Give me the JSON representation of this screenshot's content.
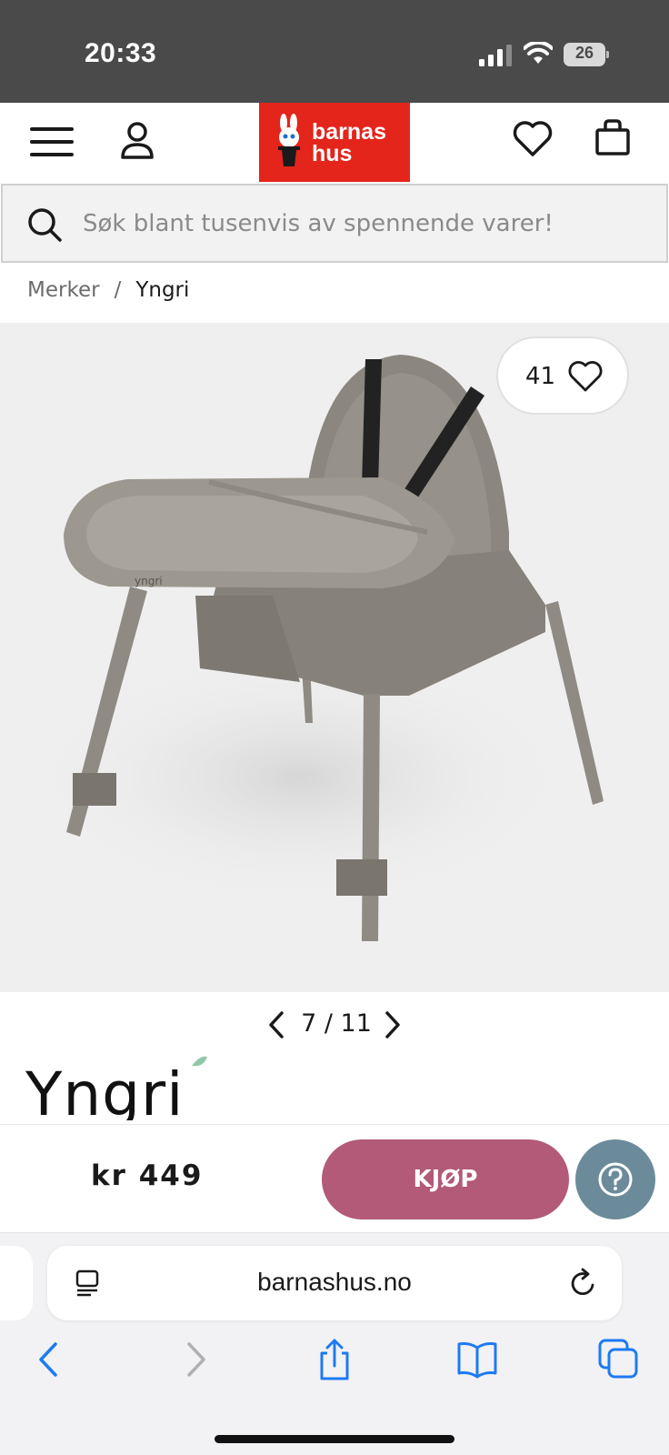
{
  "status_bar": {
    "time": "20:33",
    "battery_level": "26",
    "icons": [
      "signal-icon",
      "wifi-icon",
      "battery-icon"
    ]
  },
  "header": {
    "logo_line1": "barnas",
    "logo_line2": "hus",
    "brand_color": "#e3251b",
    "icons": [
      "menu-icon",
      "account-icon",
      "wishlist-icon",
      "cart-icon"
    ]
  },
  "search": {
    "placeholder": "Søk blant tusenvis av spennende varer!"
  },
  "breadcrumb": {
    "items": [
      "Merker",
      "Yngri"
    ],
    "separator": "/"
  },
  "product": {
    "like_count": "41",
    "gallery_position": "7 / 11",
    "brand_name": "Yngri",
    "price": "kr 449",
    "buy_label": "KJØP",
    "buy_color": "#b25a78",
    "help_color": "#6c8b9a"
  },
  "browser": {
    "url": "barnashus.no",
    "toolbar_icons": [
      "back-icon",
      "forward-icon",
      "share-icon",
      "bookmarks-icon",
      "tabs-icon"
    ]
  }
}
